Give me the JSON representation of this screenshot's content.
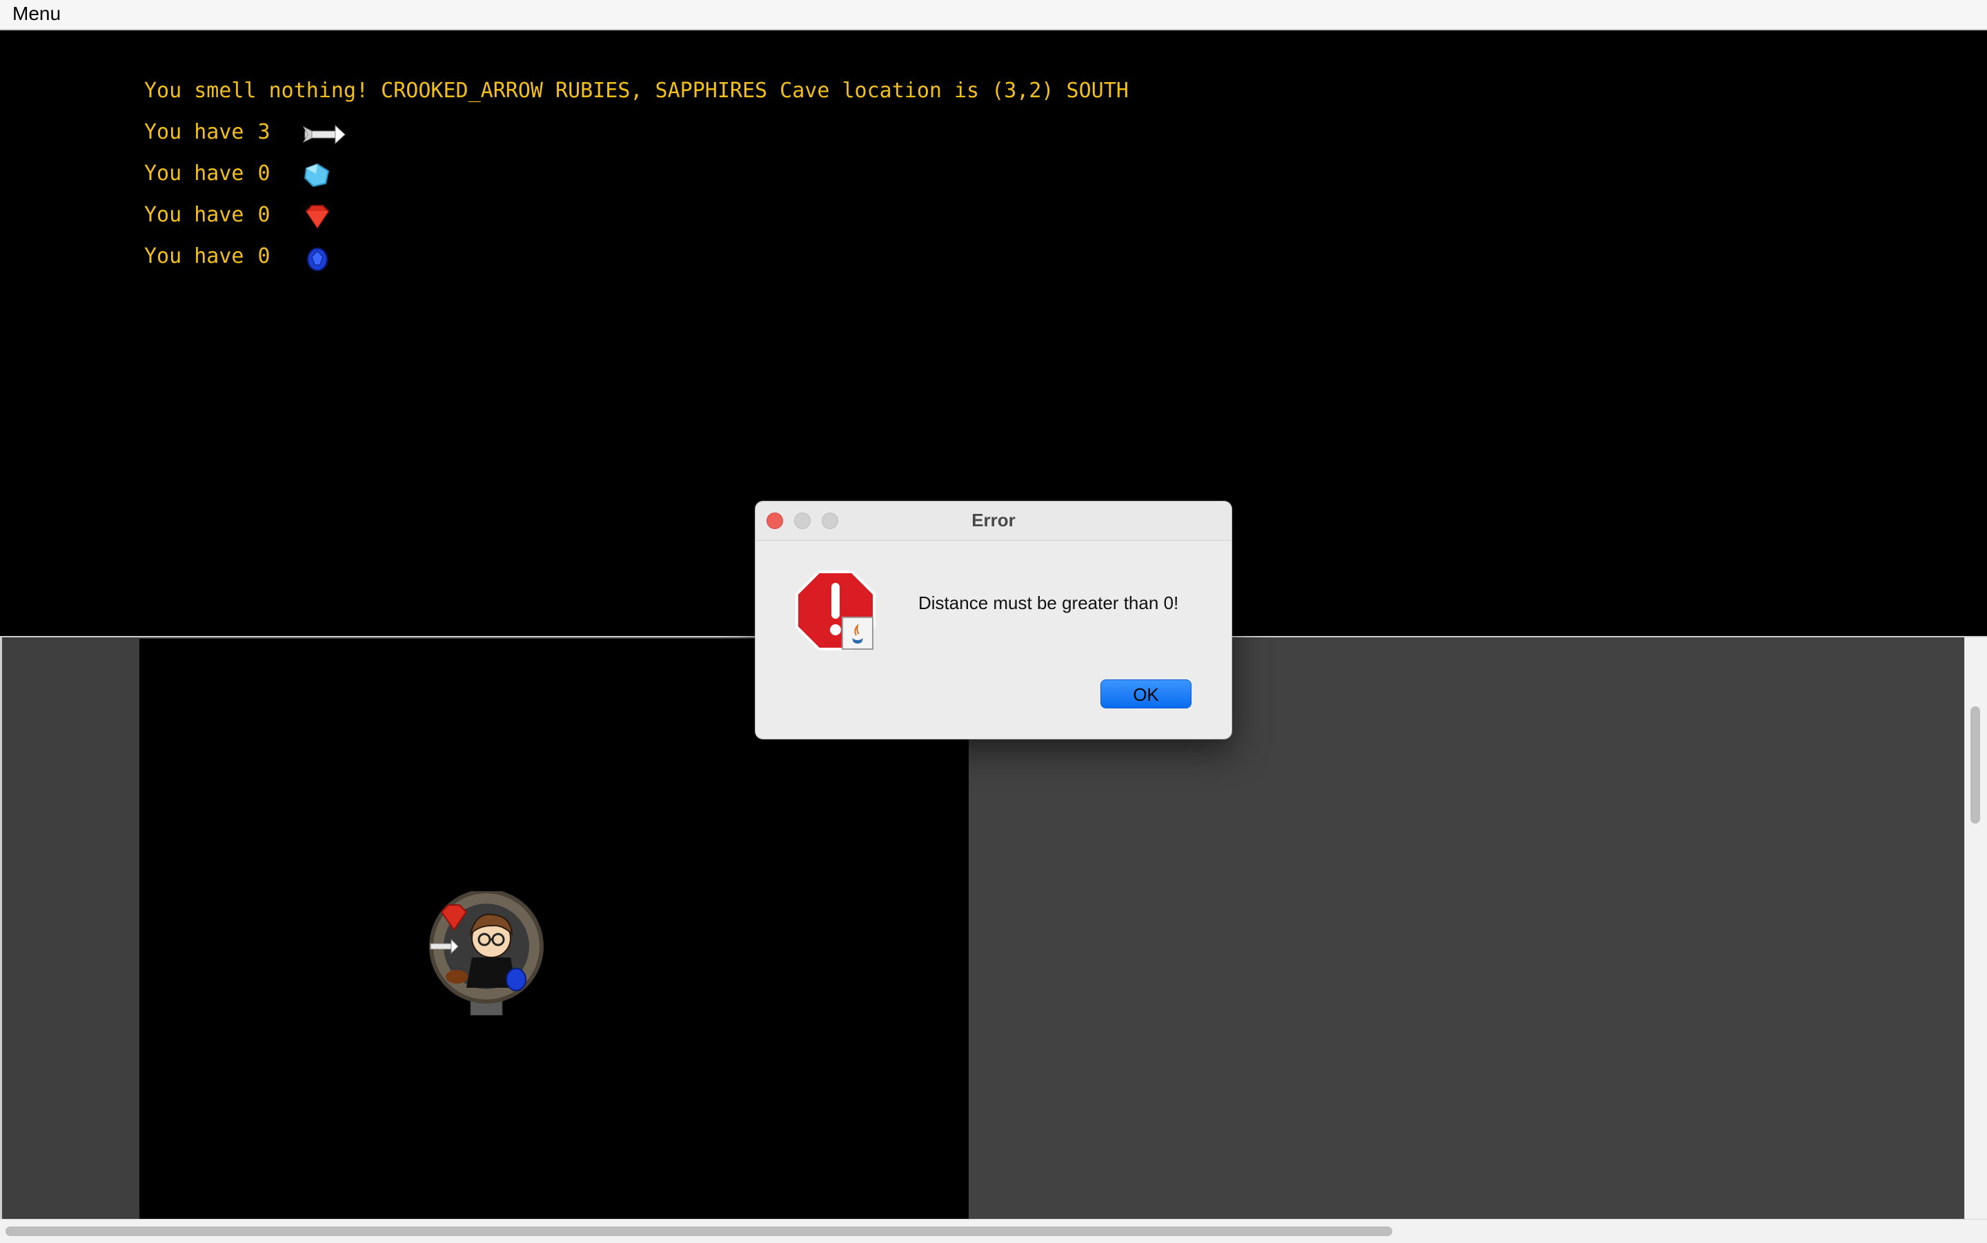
{
  "menubar": {
    "menu_label": "Menu"
  },
  "status": {
    "message": "You smell nothing! CROOKED_ARROW RUBIES, SAPPHIRES Cave location is (3,2) SOUTH",
    "inventory": [
      {
        "label": "You have",
        "count": "3",
        "icon": "arrow-icon"
      },
      {
        "label": "You have",
        "count": "0",
        "icon": "diamond-icon"
      },
      {
        "label": "You have",
        "count": "0",
        "icon": "ruby-icon"
      },
      {
        "label": "You have",
        "count": "0",
        "icon": "sapphire-icon"
      }
    ]
  },
  "dialog": {
    "title": "Error",
    "message": "Distance must be greater than 0!",
    "ok_label": "OK",
    "icon": "error-stop-icon"
  },
  "colors": {
    "text": "#f3c01a",
    "background": "#000000",
    "panel": "#424242",
    "ok_button": "#0a6cf0"
  }
}
